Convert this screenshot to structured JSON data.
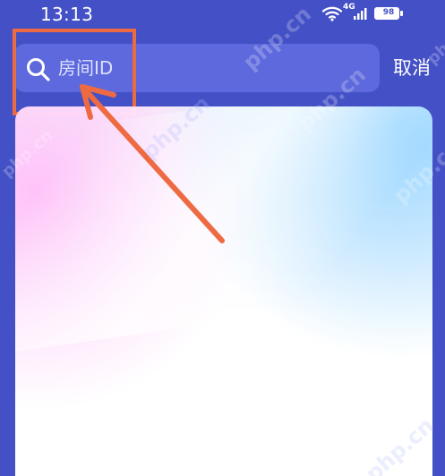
{
  "status_bar": {
    "time": "13:13",
    "signal_tag": "4G",
    "battery_level": "98"
  },
  "search": {
    "placeholder": "房间ID",
    "cancel_label": "取消"
  },
  "watermarks": [
    "php.cn",
    "php.cn",
    "php.cn",
    "php.cn",
    "php.cn",
    "php",
    "php.cn"
  ],
  "icons": {
    "search": "search-icon",
    "wifi": "wifi-icon",
    "signal": "signal-icon",
    "battery": "battery-icon"
  },
  "colors": {
    "background": "#4450c6",
    "search_box": "#5d69dc",
    "annotation": "#ee6a43"
  }
}
